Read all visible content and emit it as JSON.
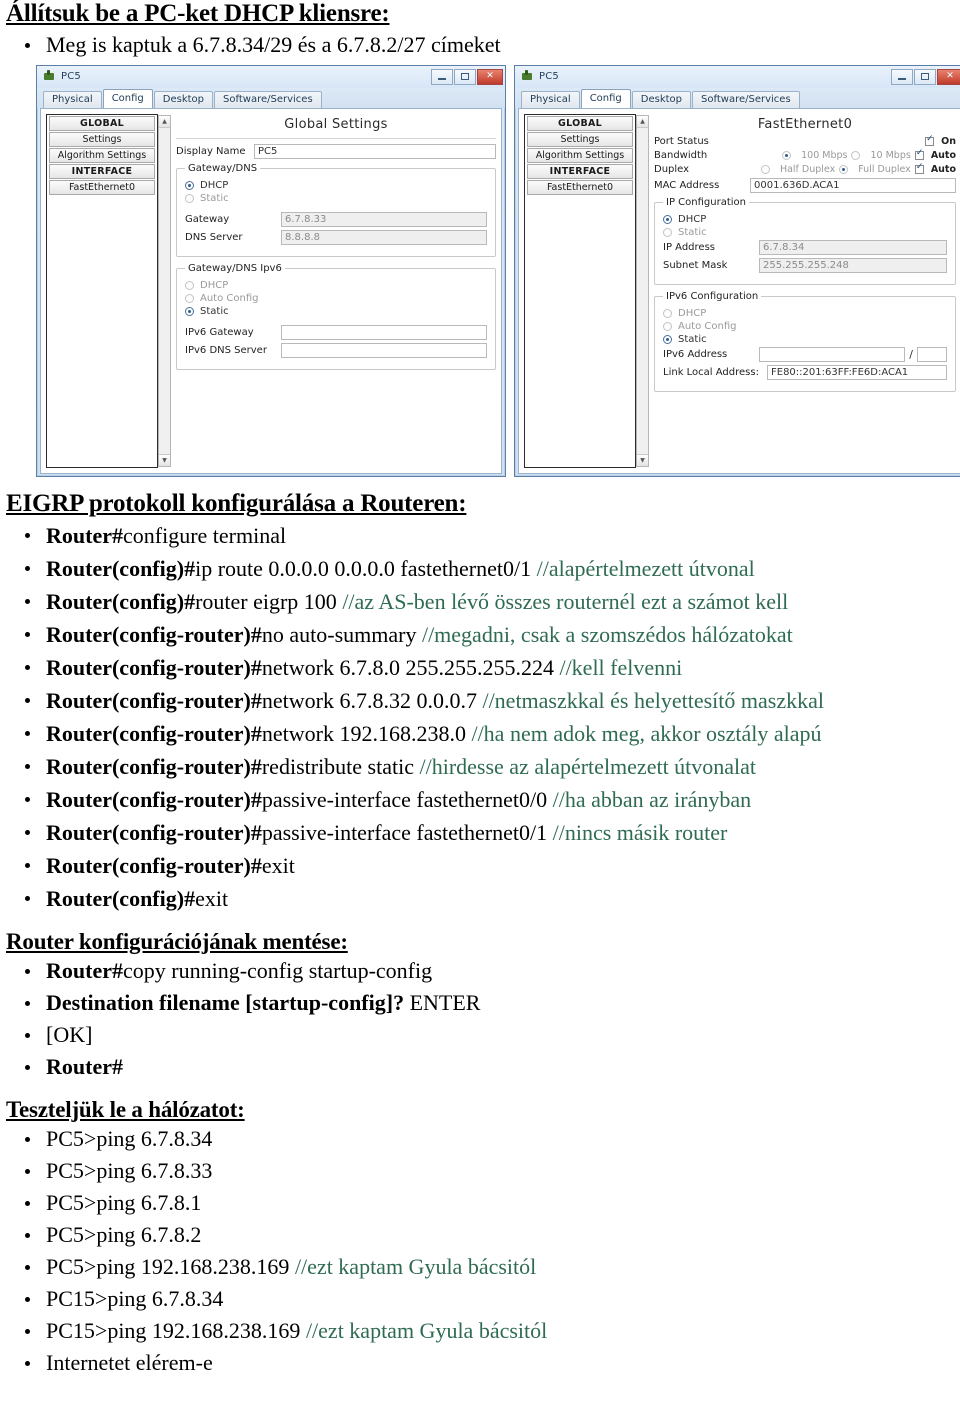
{
  "doc": {
    "heading1": "Állítsuk be a PC-ket DHCP kliensre:",
    "bullet1": "Meg is kaptuk a 6.7.8.34/29 és a 6.7.8.2/27 címeket",
    "heading2": "EIGRP protokoll konfigurálása a Routeren:",
    "heading3": "Router konfigurációjának mentése:",
    "heading4": "Teszteljük le a hálózatot:"
  },
  "eigrp_commands": [
    {
      "prompt": "Router#",
      "cmd": "configure terminal",
      "comment": ""
    },
    {
      "prompt": "Router(config)#",
      "cmd": "ip route 0.0.0.0 0.0.0.0 fastethernet0/1 ",
      "comment": "//alapértelmezett útvonal"
    },
    {
      "prompt": "Router(config)#",
      "cmd": "router eigrp 100 ",
      "comment": "//az AS-ben lévő összes routernél ezt a számot kell"
    },
    {
      "prompt": "Router(config-router)#",
      "cmd": "no auto-summary ",
      "comment": "//megadni, csak a szomszédos hálózatokat"
    },
    {
      "prompt": "Router(config-router)#",
      "cmd": "network 6.7.8.0 255.255.255.224 ",
      "comment": "//kell felvenni"
    },
    {
      "prompt": "Router(config-router)#",
      "cmd": "network 6.7.8.32 0.0.0.7 ",
      "comment": "//netmaszkkal és helyettesítő maszkkal"
    },
    {
      "prompt": "Router(config-router)#",
      "cmd": "network 192.168.238.0 ",
      "comment": "//ha nem adok meg, akkor osztály alapú"
    },
    {
      "prompt": "Router(config-router)#",
      "cmd": "redistribute static ",
      "comment": "//hirdesse az alapértelmezett útvonalat"
    },
    {
      "prompt": "Router(config-router)#",
      "cmd": "passive-interface fastethernet0/0 ",
      "comment": "//ha abban az irányban"
    },
    {
      "prompt": "Router(config-router)#",
      "cmd": "passive-interface fastethernet0/1 ",
      "comment": "//nincs másik router"
    },
    {
      "prompt": "Router(config-router)#",
      "cmd": "exit",
      "comment": ""
    },
    {
      "prompt": "Router(config)#",
      "cmd": "exit",
      "comment": ""
    }
  ],
  "save_commands": [
    {
      "prompt": "Router#",
      "cmd": "copy running-config startup-config",
      "comment": ""
    },
    {
      "prompt": "Destination filename [startup-config]? ",
      "cmd": "ENTER",
      "comment": ""
    },
    {
      "prompt": "",
      "cmd": "[OK]",
      "comment": ""
    },
    {
      "prompt": "Router#",
      "cmd": "",
      "comment": ""
    }
  ],
  "test_commands": [
    {
      "prompt": "PC5>ping 6.7.8.34",
      "comment": ""
    },
    {
      "prompt": "PC5>ping 6.7.8.33",
      "comment": ""
    },
    {
      "prompt": "PC5>ping 6.7.8.1",
      "comment": ""
    },
    {
      "prompt": "PC5>ping 6.7.8.2",
      "comment": ""
    },
    {
      "prompt": "PC5>ping 192.168.238.169 ",
      "comment": "//ezt kaptam Gyula bácsitól"
    },
    {
      "prompt": "PC15>ping 6.7.8.34",
      "comment": ""
    },
    {
      "prompt": "PC15>ping 192.168.238.169 ",
      "comment": "//ezt kaptam Gyula bácsitól"
    },
    {
      "prompt": "Internetet elérem-e",
      "comment": ""
    }
  ],
  "window_left": {
    "title": "PC5",
    "minimize_label": "—",
    "maximize_label": "❐",
    "close_label": "✕",
    "tabs": [
      {
        "label": "Physical",
        "active": false
      },
      {
        "label": "Config",
        "active": true
      },
      {
        "label": "Desktop",
        "active": false
      },
      {
        "label": "Software/Services",
        "active": false
      }
    ],
    "nav": [
      {
        "label": "GLOBAL",
        "header": true
      },
      {
        "label": "Settings",
        "header": false
      },
      {
        "label": "Algorithm Settings",
        "header": false
      },
      {
        "label": "INTERFACE",
        "header": true
      },
      {
        "label": "FastEthernet0",
        "header": false
      }
    ],
    "pane_title": "Global Settings",
    "display_name_label": "Display Name",
    "display_name_value": "PC5",
    "gateway_dns": {
      "legend": "Gateway/DNS",
      "dhcp_label": "DHCP",
      "static_label": "Static",
      "dhcp_selected": true,
      "gateway_label": "Gateway",
      "gateway_value": "6.7.8.33",
      "dns_label": "DNS Server",
      "dns_value": "8.8.8.8"
    },
    "gateway_dns_ipv6": {
      "legend": "Gateway/DNS Ipv6",
      "dhcp_label": "DHCP",
      "auto_label": "Auto Config",
      "static_label": "Static",
      "selected": "Static",
      "ipv6_gateway_label": "IPv6 Gateway",
      "ipv6_gateway_value": "",
      "ipv6_dns_label": "IPv6 DNS Server",
      "ipv6_dns_value": ""
    }
  },
  "window_right": {
    "title": "PC5",
    "minimize_label": "—",
    "maximize_label": "❐",
    "close_label": "✕",
    "tabs": [
      {
        "label": "Physical",
        "active": false
      },
      {
        "label": "Config",
        "active": true
      },
      {
        "label": "Desktop",
        "active": false
      },
      {
        "label": "Software/Services",
        "active": false
      }
    ],
    "nav": [
      {
        "label": "GLOBAL",
        "header": true
      },
      {
        "label": "Settings",
        "header": false
      },
      {
        "label": "Algorithm Settings",
        "header": false
      },
      {
        "label": "INTERFACE",
        "header": true
      },
      {
        "label": "FastEthernet0",
        "header": false
      }
    ],
    "pane_title": "FastEthernet0",
    "port_status_label": "Port Status",
    "port_status_on": "On",
    "bandwidth_label": "Bandwidth",
    "bw_100": "100 Mbps",
    "bw_10": "10 Mbps",
    "bw_auto": "Auto",
    "duplex_label": "Duplex",
    "dup_half": "Half Duplex",
    "dup_full": "Full Duplex",
    "dup_auto": "Auto",
    "mac_label": "MAC Address",
    "mac_value": "0001.636D.ACA1",
    "ip_config": {
      "legend": "IP Configuration",
      "dhcp_label": "DHCP",
      "static_label": "Static",
      "dhcp_selected": true,
      "ip_label": "IP Address",
      "ip_value": "6.7.8.34",
      "mask_label": "Subnet Mask",
      "mask_value": "255.255.255.248"
    },
    "ipv6_config": {
      "legend": "IPv6 Configuration",
      "dhcp_label": "DHCP",
      "auto_label": "Auto Config",
      "static_label": "Static",
      "selected": "Static",
      "ipv6_addr_label": "IPv6 Address",
      "ipv6_addr_value": "",
      "slash": "/",
      "prefix_value": "",
      "link_local_label": "Link Local Address:",
      "link_local_value": "FE80::201:63FF:FE6D:ACA1"
    }
  },
  "colors": {
    "comment_green": "#2f6b52",
    "window_chrome": "#d7e6f7",
    "close_red": "#c03a2b"
  }
}
